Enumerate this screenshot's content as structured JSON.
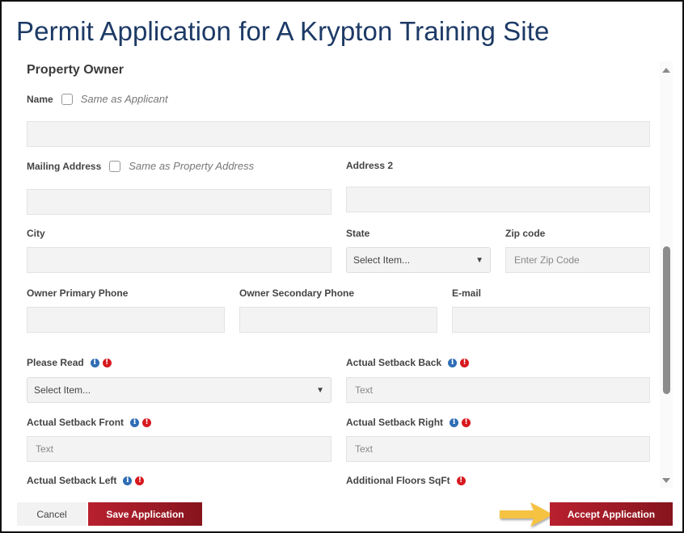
{
  "window": {
    "title": "Permit Application for A Krypton Training Site"
  },
  "section": {
    "title": "Property Owner"
  },
  "fields": {
    "name": {
      "label": "Name",
      "checkbox_label": "Same as Applicant",
      "checked": false,
      "value": ""
    },
    "mailing_address": {
      "label": "Mailing Address",
      "checkbox_label": "Same as Property Address",
      "checked": false,
      "value": ""
    },
    "address2": {
      "label": "Address 2",
      "value": ""
    },
    "city": {
      "label": "City",
      "value": ""
    },
    "state": {
      "label": "State",
      "selected": "Select Item..."
    },
    "zip": {
      "label": "Zip code",
      "placeholder": "Enter Zip Code",
      "value": ""
    },
    "primary_phone": {
      "label": "Owner Primary Phone",
      "value": ""
    },
    "secondary_phone": {
      "label": "Owner Secondary Phone",
      "value": ""
    },
    "email": {
      "label": "E-mail",
      "value": ""
    },
    "please_read": {
      "label": "Please Read",
      "selected": "Select Item..."
    },
    "setback_back": {
      "label": "Actual Setback Back",
      "placeholder": "Text"
    },
    "setback_front": {
      "label": "Actual Setback Front",
      "placeholder": "Text"
    },
    "setback_right": {
      "label": "Actual Setback Right",
      "placeholder": "Text"
    },
    "setback_left": {
      "label": "Actual Setback Left"
    },
    "additional_floors": {
      "label": "Additional Floors SqFt"
    }
  },
  "icons": {
    "info": "i",
    "required": "!"
  },
  "footer": {
    "cancel_label": "Cancel",
    "save_label": "Save Application",
    "accept_label": "Accept Application"
  },
  "colors": {
    "title": "#1d3a66",
    "primary_button": "#a51d28",
    "info_icon": "#2f6db5",
    "required_icon": "#d7191f",
    "annotation_arrow": "#f5c242"
  },
  "scrollbar": {
    "position_fraction": 0.44
  }
}
